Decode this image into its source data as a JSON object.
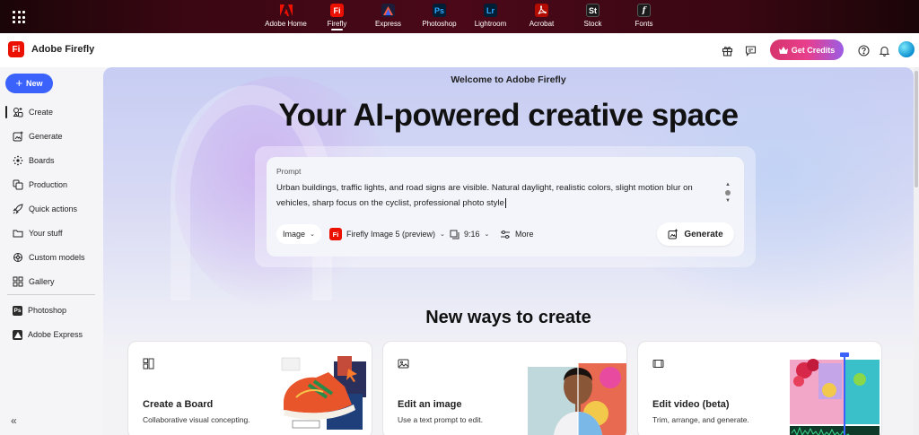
{
  "app_switcher": {
    "apps": [
      {
        "label": "Adobe Home",
        "icon": "adobe-logo-icon",
        "glyph": "A",
        "color": "#eb1000"
      },
      {
        "label": "Firefly",
        "icon": "firefly-icon",
        "glyph": "Fi",
        "color": "#eb1000",
        "active": true
      },
      {
        "label": "Express",
        "icon": "express-icon",
        "glyph": "A",
        "color": "#1d1d3a"
      },
      {
        "label": "Photoshop",
        "icon": "photoshop-icon",
        "glyph": "Ps",
        "color": "#001e36"
      },
      {
        "label": "Lightroom",
        "icon": "lightroom-icon",
        "glyph": "Lr",
        "color": "#001e36"
      },
      {
        "label": "Acrobat",
        "icon": "acrobat-icon",
        "glyph": "A",
        "color": "#b30b00"
      },
      {
        "label": "Stock",
        "icon": "stock-icon",
        "glyph": "St",
        "color": "#1a1a1a"
      },
      {
        "label": "Fonts",
        "icon": "fonts-icon",
        "glyph": "f",
        "color": "#1a1a1a"
      }
    ]
  },
  "header": {
    "brand_glyph": "Fi",
    "brand_name": "Adobe Firefly",
    "credits_label": "Get Credits"
  },
  "sidebar": {
    "new_label": "New",
    "items": [
      {
        "label": "Create",
        "icon": "create-icon"
      },
      {
        "label": "Generate",
        "icon": "generate-icon"
      },
      {
        "label": "Boards",
        "icon": "boards-icon"
      },
      {
        "label": "Production",
        "icon": "production-icon"
      },
      {
        "label": "Quick actions",
        "icon": "quick-actions-icon"
      },
      {
        "label": "Your stuff",
        "icon": "folder-icon"
      },
      {
        "label": "Custom models",
        "icon": "custom-models-icon"
      },
      {
        "label": "Gallery",
        "icon": "gallery-icon"
      }
    ],
    "apps": [
      {
        "label": "Photoshop",
        "icon": "photoshop-icon"
      },
      {
        "label": "Adobe Express",
        "icon": "express-icon"
      }
    ],
    "collapse_glyph": "«"
  },
  "hero": {
    "welcome": "Welcome to Adobe Firefly",
    "title": "Your AI-powered creative space"
  },
  "prompt": {
    "label": "Prompt",
    "text": "Urban buildings, traffic lights, and road signs are visible. Natural daylight, realistic colors, slight motion blur on vehicles, sharp focus on the cyclist, professional photo style",
    "type_label": "Image",
    "model_glyph": "Fi",
    "model_label": "Firefly Image 5 (preview)",
    "ratio_label": "9:16",
    "more_label": "More",
    "generate_label": "Generate"
  },
  "new_ways": {
    "title": "New ways to create",
    "cards": [
      {
        "title": "Create a Board",
        "subtitle": "Collaborative visual concepting.",
        "icon": "board-icon"
      },
      {
        "title": "Edit an image",
        "subtitle": "Use a text prompt to edit.",
        "icon": "image-icon"
      },
      {
        "title": "Edit video (beta)",
        "subtitle": "Trim, arrange, and generate.",
        "icon": "video-icon"
      }
    ]
  }
}
